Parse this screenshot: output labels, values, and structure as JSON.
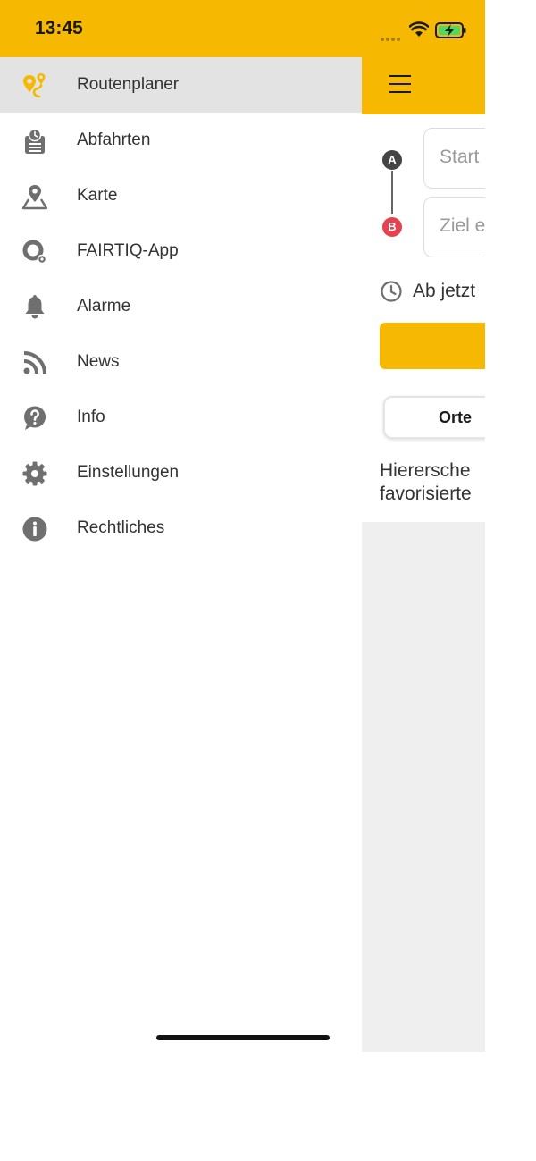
{
  "status_bar": {
    "time": "13:45"
  },
  "drawer": {
    "items": [
      {
        "label": "Routenplaner",
        "icon": "route-planner-icon",
        "active": true
      },
      {
        "label": "Abfahrten",
        "icon": "departures-board-icon"
      },
      {
        "label": "Karte",
        "icon": "map-pin-icon"
      },
      {
        "label": "FAIRTIQ-App",
        "icon": "fairtiq-icon"
      },
      {
        "label": "Alarme",
        "icon": "bell-icon"
      },
      {
        "label": "News",
        "icon": "rss-icon"
      },
      {
        "label": "Info",
        "icon": "question-icon"
      },
      {
        "label": "Einstellungen",
        "icon": "gear-icon"
      },
      {
        "label": "Rechtliches",
        "icon": "info-icon"
      }
    ]
  },
  "main": {
    "badge_a": "A",
    "badge_b": "B",
    "start_placeholder": "Start",
    "ziel_placeholder": "Ziel e",
    "time_label": "Ab jetzt",
    "segment_label": "Orte",
    "empty_message": "Hierersche\nfavorisierte"
  },
  "colors": {
    "accent": "#f6b800",
    "badge_b": "#e5424d",
    "badge_a": "#444444",
    "icon_gray": "#6f6f6f"
  }
}
